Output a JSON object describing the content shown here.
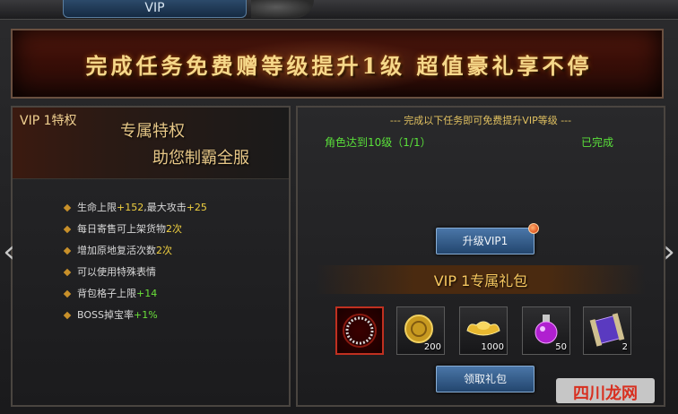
{
  "tab": {
    "label": "VIP"
  },
  "banner": {
    "text": "完成任务免费赠等级提升1级 超值豪礼享不停"
  },
  "left": {
    "vip_title": "VIP 1特权",
    "slogan_line1": "专属特权",
    "slogan_line2": "助您制霸全服",
    "perks": [
      {
        "text": "生命上限",
        "value": "+152",
        "text2": ",最大攻击",
        "value2": "+25"
      },
      {
        "text": "每日寄售可上架货物",
        "value": "2次"
      },
      {
        "text": "增加原地复活次数",
        "value": "2次"
      },
      {
        "text": "可以使用特殊表情"
      },
      {
        "text": "背包格子上限",
        "value": "+14"
      },
      {
        "text": "BOSS掉宝率",
        "value": "+1%"
      }
    ]
  },
  "right": {
    "task_title": "--- 完成以下任务即可免费提升VIP等级 ---",
    "task_desc": "角色达到10级（1/1）",
    "task_status": "已完成",
    "upgrade_button": "升级VIP1",
    "pack_title": "VIP 1专属礼包",
    "items": [
      {
        "name": "ring-icon",
        "qty": ""
      },
      {
        "name": "coin-icon",
        "qty": "200"
      },
      {
        "name": "gold-ingot-icon",
        "qty": "1000"
      },
      {
        "name": "potion-icon",
        "qty": "50"
      },
      {
        "name": "scroll-icon",
        "qty": "2"
      }
    ],
    "claim_button": "领取礼包"
  },
  "watermark": {
    "text": "四川龙网"
  },
  "colors": {
    "green": "#5ae03a",
    "gold": "#f6d88a",
    "button_blue": "#23466e"
  }
}
